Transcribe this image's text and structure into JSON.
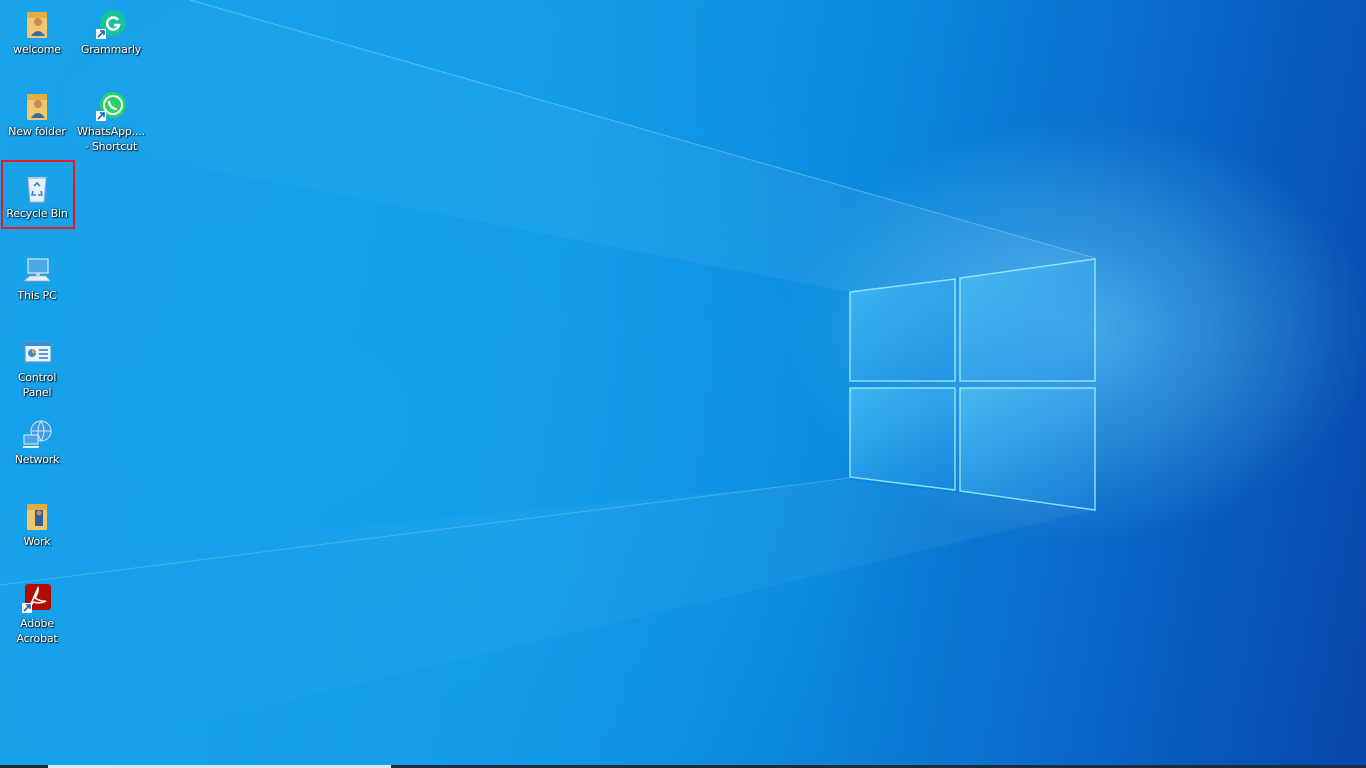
{
  "desktop": {
    "icons": [
      {
        "id": "welcome",
        "label": "welcome",
        "icon": "user-folder-icon"
      },
      {
        "id": "grammarly",
        "label": "Grammarly",
        "icon": "grammarly-icon"
      },
      {
        "id": "new-folder",
        "label": "New folder",
        "icon": "user-folder-icon"
      },
      {
        "id": "whatsapp",
        "label": "WhatsApp....\n- Shortcut",
        "icon": "whatsapp-icon"
      },
      {
        "id": "recycle-bin",
        "label": "Recycle Bin",
        "icon": "recycle-bin-icon"
      },
      {
        "id": "this-pc",
        "label": "This PC",
        "icon": "computer-icon"
      },
      {
        "id": "control-panel",
        "label": "Control\nPanel",
        "icon": "control-panel-icon"
      },
      {
        "id": "network",
        "label": "Network",
        "icon": "network-icon"
      },
      {
        "id": "work",
        "label": "Work",
        "icon": "user-folder-icon"
      },
      {
        "id": "adobe-acrobat",
        "label": "Adobe\nAcrobat",
        "icon": "adobe-acrobat-icon"
      }
    ],
    "highlighted_icon": "recycle-bin",
    "highlight_color": "#e01b24"
  },
  "wallpaper": {
    "name": "windows-logo-wallpaper",
    "accent": "#1aa4ea",
    "dark": "#0746ab"
  }
}
